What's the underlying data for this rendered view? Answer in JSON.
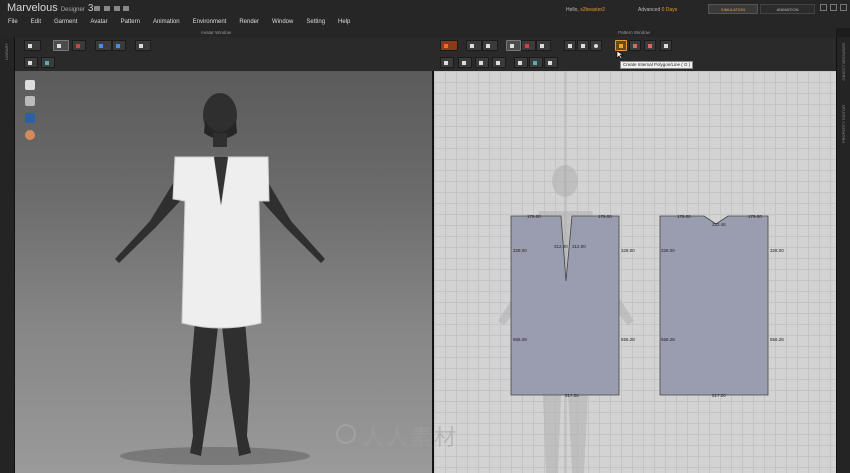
{
  "app": {
    "name": "Marvelous",
    "sub": "Designer",
    "version": "3"
  },
  "user": {
    "greeting": "Hello,",
    "name": "s2beaster2"
  },
  "license": {
    "tier": "Advanced",
    "days": "0 Days"
  },
  "modes": {
    "simulation": "SIMULATION",
    "animation": "ANIMATION"
  },
  "menu": [
    "File",
    "Edit",
    "Garment",
    "Avatar",
    "Pattern",
    "Animation",
    "Environment",
    "Render",
    "Window",
    "Setting",
    "Help"
  ],
  "panels": {
    "avatar_window": "Avatar Window",
    "pattern_window": "Pattern Window"
  },
  "sidebar": {
    "left_tab": "LIBRARY",
    "right_tab_top": "OBJECT BROWSER",
    "right_tab_bottom": "PROPERTY EDITOR"
  },
  "tooltip": "Create Internal Polygon/Line ( G )",
  "patterns": {
    "front": {
      "top_left": "179.00",
      "top_right": "179.00",
      "v_left": "312.00",
      "v_right": "312.00",
      "side_left_top": "328.00",
      "side_right_top": "328.00",
      "side_left_bottom": "556.28",
      "side_right_bottom": "556.28",
      "bottom": "517.00"
    },
    "back": {
      "top_left": "179.00",
      "top_right": "179.00",
      "neck": "222.46",
      "side_left_top": "328.00",
      "side_right_top": "328.00",
      "side_left_bottom": "556.28",
      "side_right_bottom": "556.28",
      "bottom": "517.00"
    }
  },
  "watermark": "人人素材",
  "colors": {
    "accent": "#e89a2a",
    "pattern_fill": "#9a9db0",
    "avatar_skin": "#2f2f2f",
    "garment": "#eeeeee"
  }
}
